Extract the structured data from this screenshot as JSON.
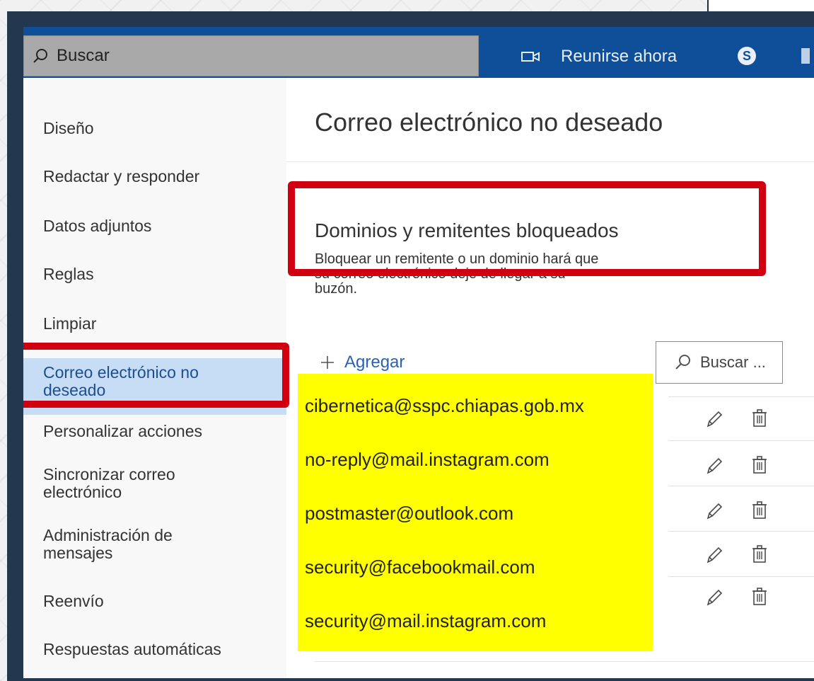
{
  "header": {
    "search_placeholder": "Buscar",
    "meet_label": "Reunirse ahora",
    "skype_glyph": "S"
  },
  "sidebar": {
    "items": [
      {
        "label": "Diseño"
      },
      {
        "label": "Redactar y responder"
      },
      {
        "label": "Datos adjuntos"
      },
      {
        "label": "Reglas"
      },
      {
        "label": "Limpiar"
      },
      {
        "label": "Correo electrónico no deseado",
        "selected": true
      },
      {
        "label": "Personalizar acciones"
      },
      {
        "label": "Sincronizar correo electrónico"
      },
      {
        "label": "Administración de mensajes"
      },
      {
        "label": "Reenvío"
      },
      {
        "label": "Respuestas automáticas"
      }
    ]
  },
  "main": {
    "title": "Correo electrónico no deseado",
    "section_title": "Dominios y remitentes bloqueados",
    "section_desc": "Bloquear un remitente o un dominio hará que su correo electrónico deje de llegar a su buzón.",
    "add_label": "Agregar",
    "list_search_placeholder": "Buscar ...",
    "blocked": [
      "cibernetica@sspc.chiapas.gob.mx",
      "no-reply@mail.instagram.com",
      "postmaster@outlook.com",
      "security@facebookmail.com",
      "security@mail.instagram.com"
    ]
  },
  "colors": {
    "header_blue": "#0f4f9a",
    "highlight_yellow": "#ffff00",
    "annotation_red": "#d10010",
    "selected_bg": "#c7dcf5",
    "link_blue": "#2a63b2"
  },
  "icons": [
    "search-icon",
    "video-camera-icon",
    "skype-icon",
    "plus-icon",
    "pencil-icon",
    "trash-icon"
  ]
}
